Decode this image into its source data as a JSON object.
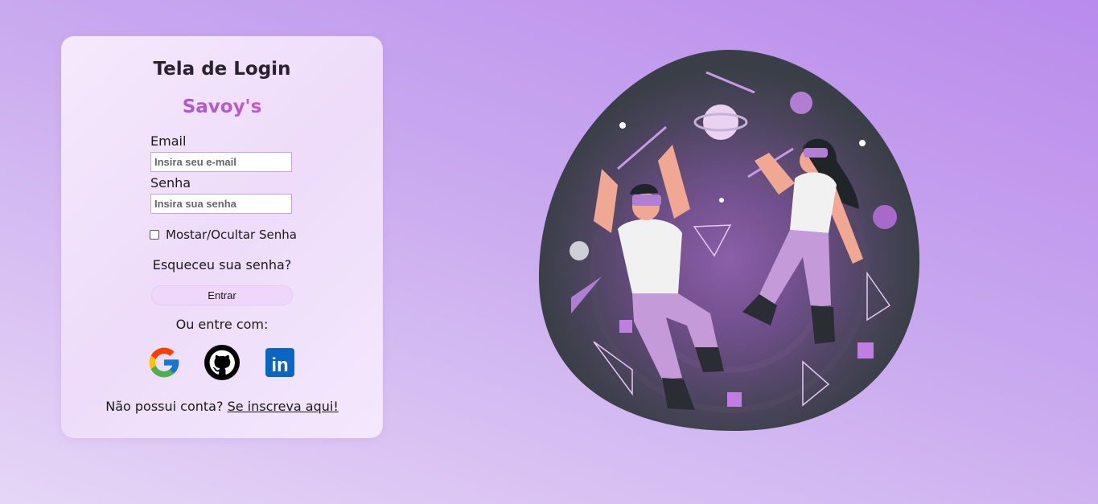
{
  "login": {
    "title": "Tela de Login",
    "brand": "Savoy's",
    "email_label": "Email",
    "email_placeholder": "Insira seu e-mail",
    "password_label": "Senha",
    "password_placeholder": "Insira sua senha",
    "show_password_label": "Mostar/Ocultar Senha",
    "forgot_password": "Esqueceu sua senha?",
    "submit_label": "Entrar",
    "social_prompt": "Ou entre com:",
    "social": [
      {
        "icon": "google-icon"
      },
      {
        "icon": "github-icon"
      },
      {
        "icon": "linkedin-icon",
        "text": "in"
      }
    ],
    "signup_prompt": "Não possui conta? ",
    "signup_link": "Se inscreva aqui!"
  },
  "colors": {
    "brand_gradient_start": "#8e5ae0",
    "brand_gradient_end": "#e058b7",
    "card_background": "#f3e6fc",
    "page_background": "#c9a9ef",
    "linkedin_blue": "#0a66c2"
  },
  "illustration": {
    "icon": "vr-space-illustration"
  }
}
